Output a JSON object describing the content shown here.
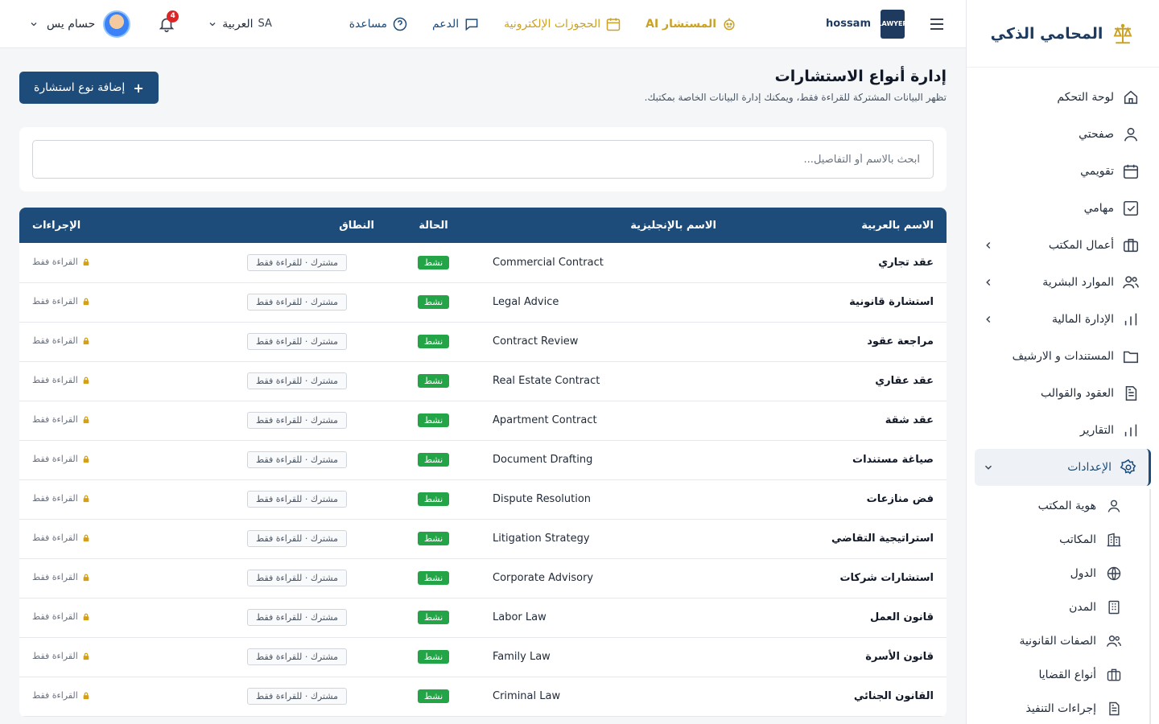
{
  "brand": {
    "name": "المحامي الذكي"
  },
  "sidebar": {
    "items": [
      {
        "label": "لوحة التحكم",
        "icon": "home-icon",
        "chevron": false
      },
      {
        "label": "صفحتي",
        "icon": "user-icon",
        "chevron": false
      },
      {
        "label": "تقويمي",
        "icon": "calendar-icon",
        "chevron": false
      },
      {
        "label": "مهامي",
        "icon": "check-square-icon",
        "chevron": false
      },
      {
        "label": "أعمال المكتب",
        "icon": "briefcase-icon",
        "chevron": true
      },
      {
        "label": "الموارد البشرية",
        "icon": "users-icon",
        "chevron": true
      },
      {
        "label": "الإدارة المالية",
        "icon": "bar-chart-icon",
        "chevron": true
      },
      {
        "label": "المستندات و الارشيف",
        "icon": "folder-icon",
        "chevron": false
      },
      {
        "label": "العقود والقوالب",
        "icon": "file-text-icon",
        "chevron": false
      },
      {
        "label": "التقارير",
        "icon": "bar-chart-icon",
        "chevron": false
      }
    ],
    "active": {
      "label": "الإعدادات",
      "icon": "gear-icon"
    },
    "sub_items": [
      {
        "label": "هوية المكتب",
        "icon": "user-icon"
      },
      {
        "label": "المكاتب",
        "icon": "building-icon"
      },
      {
        "label": "الدول",
        "icon": "globe-icon"
      },
      {
        "label": "المدن",
        "icon": "city-icon"
      },
      {
        "label": "الصفات القانونية",
        "icon": "users-icon"
      },
      {
        "label": "أنواع القضايا",
        "icon": "briefcase-icon"
      },
      {
        "label": "إجراءات التنفيذ",
        "icon": "file-text-icon"
      }
    ]
  },
  "header": {
    "user_code": "hossam",
    "logo_text": "LAWYER",
    "ai_label": "المستشار AI",
    "booking_label": "الحجوزات الإلكترونية",
    "support_label": "الدعم",
    "help_label": "مساعدة",
    "language_label": "العربية",
    "language_code": "SA",
    "notifications_count": "4",
    "user_name": "حسام يس"
  },
  "page": {
    "title": "إدارة أنواع الاستشارات",
    "subtitle": "تظهر البيانات المشتركة للقراءة فقط، ويمكنك إدارة البيانات الخاصة بمكتبك.",
    "add_button": "إضافة نوع استشارة",
    "search_placeholder": "ابحث بالاسم أو التفاصيل..."
  },
  "table": {
    "headers": {
      "name_ar": "الاسم بالعربية",
      "name_en": "الاسم بالإنجليزية",
      "status": "الحالة",
      "scope": "النطاق",
      "actions": "الإجراءات"
    },
    "rows": [
      {
        "name_ar": "عقد تجاري",
        "name_en": "Commercial Contract",
        "status": "نشط",
        "scope": "مشترك · للقراءة فقط",
        "action": "القراءة فقط"
      },
      {
        "name_ar": "استشارة قانونية",
        "name_en": "Legal Advice",
        "status": "نشط",
        "scope": "مشترك · للقراءة فقط",
        "action": "القراءة فقط"
      },
      {
        "name_ar": "مراجعة عقود",
        "name_en": "Contract Review",
        "status": "نشط",
        "scope": "مشترك · للقراءة فقط",
        "action": "القراءة فقط"
      },
      {
        "name_ar": "عقد عقاري",
        "name_en": "Real Estate Contract",
        "status": "نشط",
        "scope": "مشترك · للقراءة فقط",
        "action": "القراءة فقط"
      },
      {
        "name_ar": "عقد شقة",
        "name_en": "Apartment Contract",
        "status": "نشط",
        "scope": "مشترك · للقراءة فقط",
        "action": "القراءة فقط"
      },
      {
        "name_ar": "صياغة مستندات",
        "name_en": "Document Drafting",
        "status": "نشط",
        "scope": "مشترك · للقراءة فقط",
        "action": "القراءة فقط"
      },
      {
        "name_ar": "فض منازعات",
        "name_en": "Dispute Resolution",
        "status": "نشط",
        "scope": "مشترك · للقراءة فقط",
        "action": "القراءة فقط"
      },
      {
        "name_ar": "استراتيجية التقاضي",
        "name_en": "Litigation Strategy",
        "status": "نشط",
        "scope": "مشترك · للقراءة فقط",
        "action": "القراءة فقط"
      },
      {
        "name_ar": "استشارات شركات",
        "name_en": "Corporate Advisory",
        "status": "نشط",
        "scope": "مشترك · للقراءة فقط",
        "action": "القراءة فقط"
      },
      {
        "name_ar": "قانون العمل",
        "name_en": "Labor Law",
        "status": "نشط",
        "scope": "مشترك · للقراءة فقط",
        "action": "القراءة فقط"
      },
      {
        "name_ar": "قانون الأسرة",
        "name_en": "Family Law",
        "status": "نشط",
        "scope": "مشترك · للقراءة فقط",
        "action": "القراءة فقط"
      },
      {
        "name_ar": "القانون الجنائي",
        "name_en": "Criminal Law",
        "status": "نشط",
        "scope": "مشترك · للقراءة فقط",
        "action": "القراءة فقط"
      }
    ]
  },
  "colors": {
    "primary": "#1e4c7a",
    "accent_gold": "#c9a227",
    "status_active": "#22a447",
    "badge_red": "#dc2626"
  }
}
